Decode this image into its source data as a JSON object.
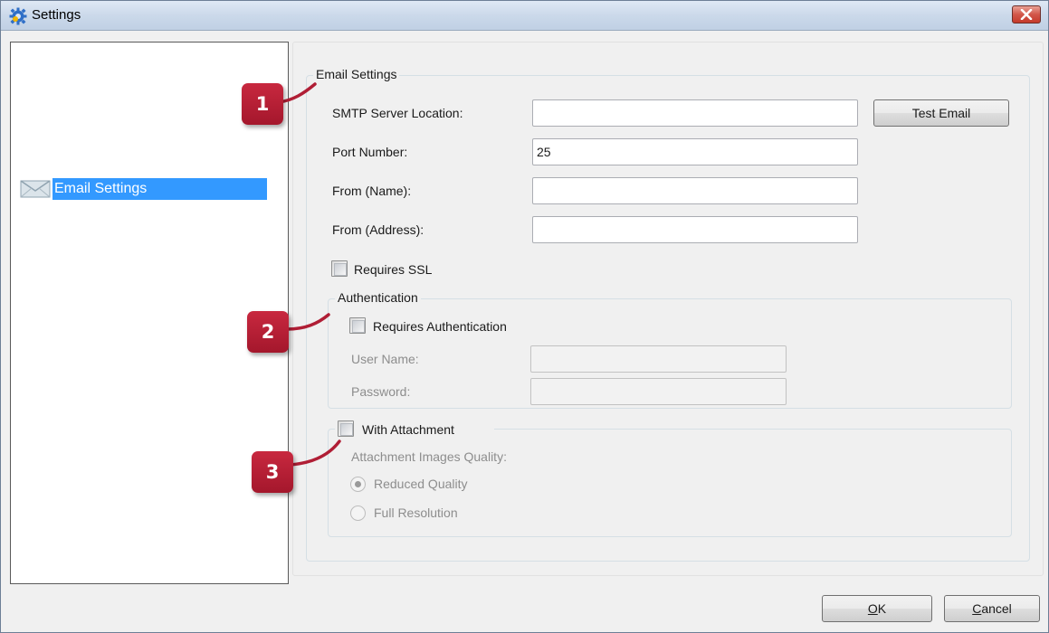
{
  "window": {
    "title": "Settings",
    "close_icon": "close-icon"
  },
  "tree": {
    "items": [
      {
        "label": "Email Settings",
        "icon": "envelope-icon",
        "selected": true
      }
    ]
  },
  "email_settings": {
    "group_title": "Email Settings",
    "smtp_label": "SMTP Server Location:",
    "smtp_value": "",
    "test_button": "Test Email",
    "port_label": "Port Number:",
    "port_value": "25",
    "from_name_label": "From (Name):",
    "from_name_value": "",
    "from_address_label": "From (Address):",
    "from_address_value": "",
    "ssl_label": "Requires SSL",
    "ssl_checked": false
  },
  "authentication": {
    "group_title": "Authentication",
    "requires_label": "Requires Authentication",
    "requires_checked": false,
    "username_label": "User Name:",
    "username_value": "",
    "password_label": "Password:",
    "password_value": ""
  },
  "attachment": {
    "with_attachment_label": "With Attachment",
    "with_attachment_checked": false,
    "quality_label": "Attachment Images Quality:",
    "options": [
      {
        "label": "Reduced Quality",
        "selected": true
      },
      {
        "label": "Full Resolution",
        "selected": false
      }
    ]
  },
  "callouts": [
    "1",
    "2",
    "3"
  ],
  "footer": {
    "ok_accel": "O",
    "ok_rest": "K",
    "cancel_accel": "C",
    "cancel_rest": "ancel"
  },
  "colors": {
    "selection": "#3399ff",
    "callout": "#b01e35"
  }
}
